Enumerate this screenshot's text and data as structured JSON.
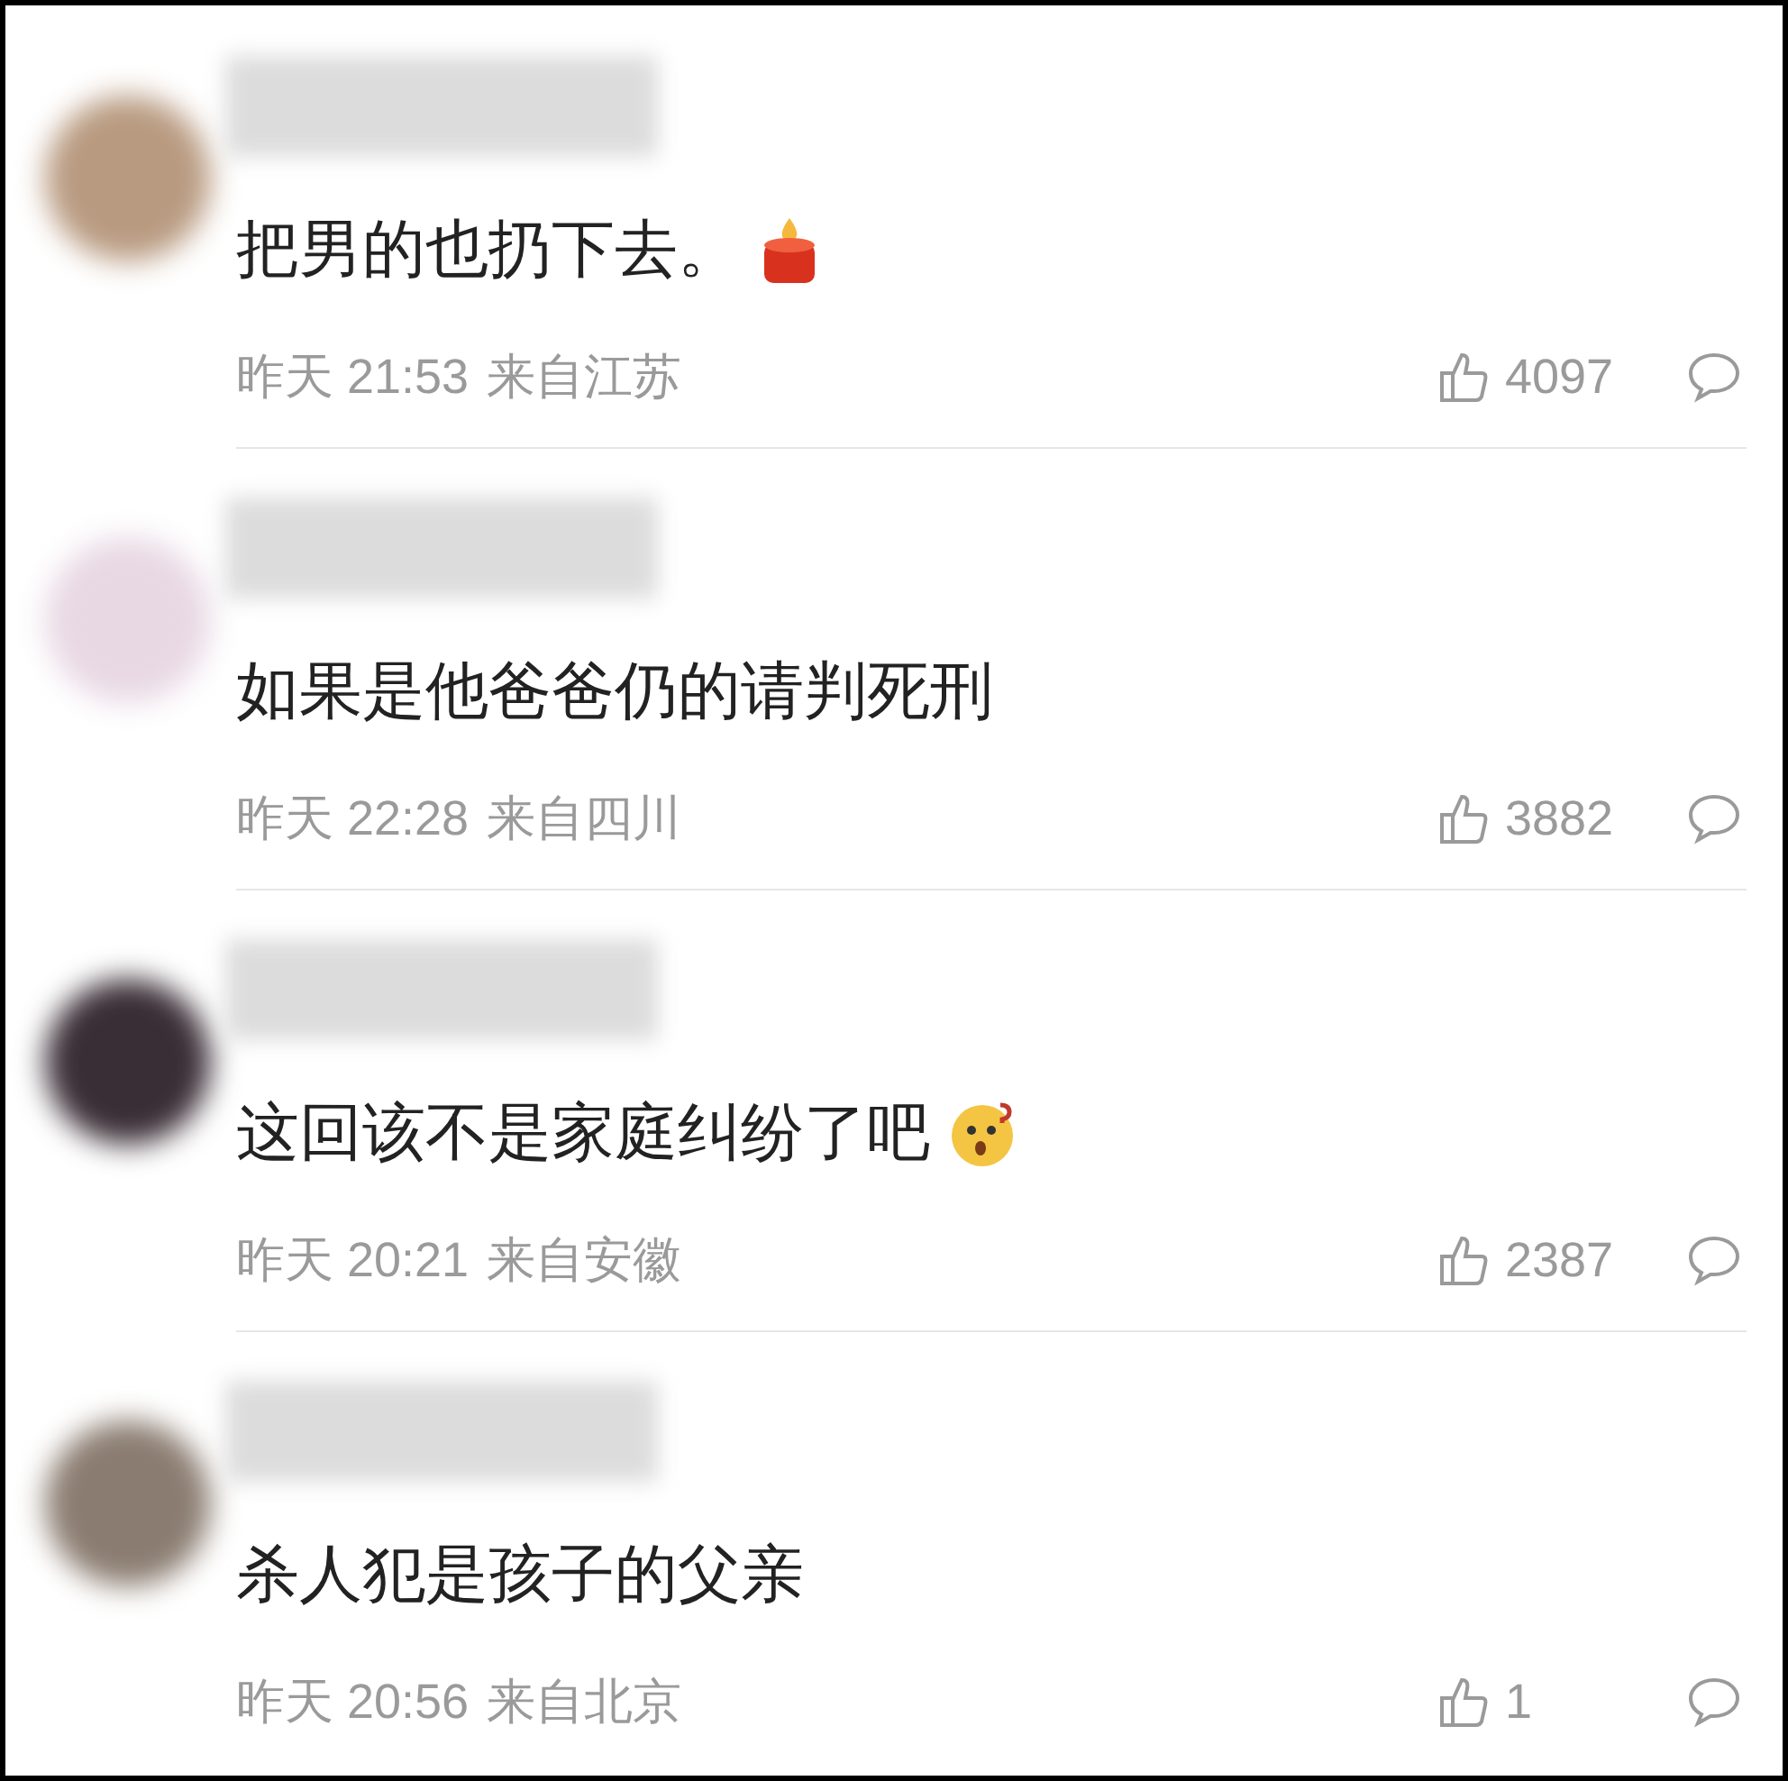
{
  "comments": [
    {
      "text": "把男的也扔下去。",
      "emoji": {
        "kind": "candle"
      },
      "time": "昨天 21:53",
      "location": "来自江苏",
      "likes": "4097"
    },
    {
      "text": "如果是他爸爸仍的请判死刑",
      "time": "昨天 22:28",
      "location": "来自四川",
      "likes": "3882"
    },
    {
      "text": "这回该不是家庭纠纷了吧",
      "emoji": {
        "kind": "surprised"
      },
      "time": "昨天 20:21",
      "location": "来自安徽",
      "likes": "2387"
    },
    {
      "text": "杀人犯是孩子的父亲",
      "time": "昨天 20:56",
      "location": "来自北京",
      "likes": "1"
    }
  ]
}
